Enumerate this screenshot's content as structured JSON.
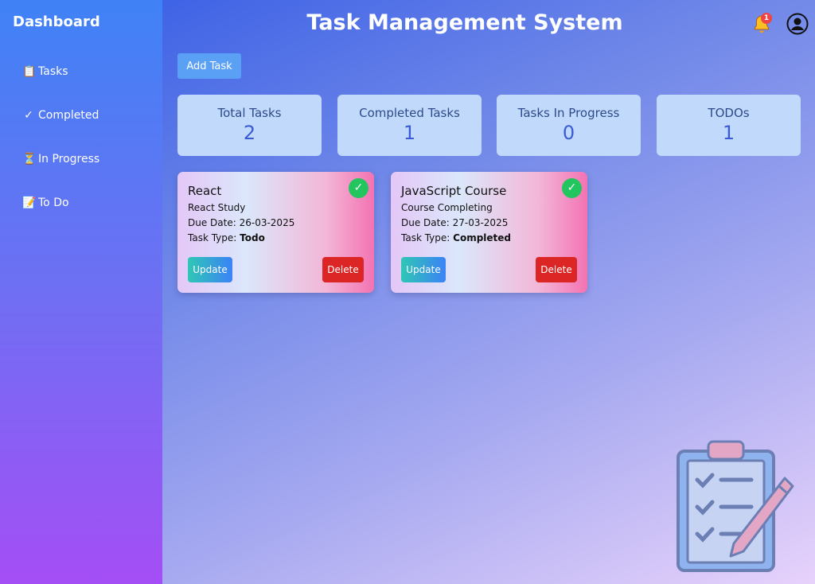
{
  "sidebar": {
    "title": "Dashboard",
    "items": [
      {
        "glyph": "📋",
        "label": "Tasks",
        "icon": "clipboard-icon"
      },
      {
        "glyph": "✓",
        "label": "Completed",
        "icon": "check-icon"
      },
      {
        "glyph": "⏳",
        "label": "In Progress",
        "icon": "hourglass-icon"
      },
      {
        "glyph": "📝",
        "label": "To Do",
        "icon": "memo-icon"
      }
    ]
  },
  "header": {
    "title": "Task Management System",
    "notification_count": "1"
  },
  "toolbar": {
    "add_label": "Add Task"
  },
  "stats": [
    {
      "label": "Total Tasks",
      "value": "2"
    },
    {
      "label": "Completed Tasks",
      "value": "1"
    },
    {
      "label": "Tasks In Progress",
      "value": "0"
    },
    {
      "label": "TODOs",
      "value": "1"
    }
  ],
  "tasks": [
    {
      "title": "React",
      "description": "React Study",
      "due_prefix": "Due Date: ",
      "due": "26-03-2025",
      "type_prefix": "Task Type: ",
      "type": "Todo",
      "check": "✓",
      "update_label": "Update",
      "delete_label": "Delete"
    },
    {
      "title": "JavaScript Course",
      "description": "Course Completing",
      "due_prefix": "Due Date: ",
      "due": "27-03-2025",
      "type_prefix": "Task Type: ",
      "type": "Completed",
      "check": "✓",
      "update_label": "Update",
      "delete_label": "Delete"
    }
  ],
  "colors": {
    "accent": "#3f82f6",
    "success": "#22c55e",
    "danger": "#dc2626"
  }
}
